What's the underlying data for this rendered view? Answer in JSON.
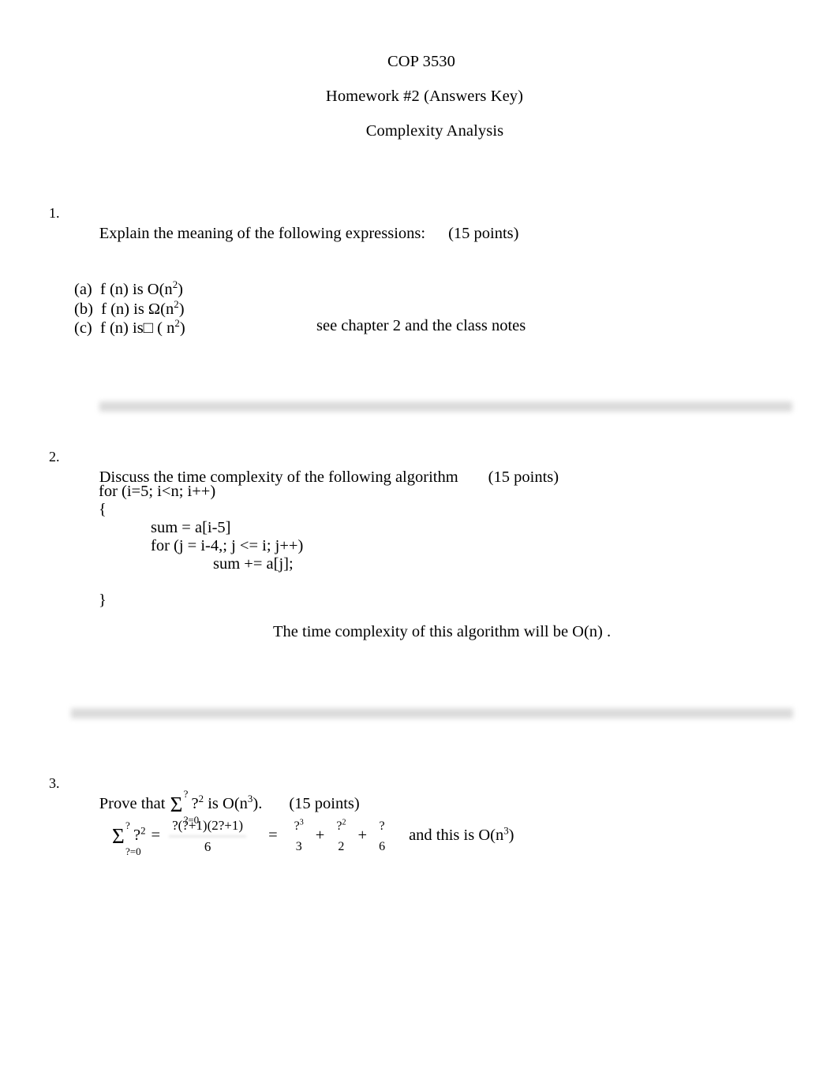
{
  "document": {
    "header": {
      "course": "COP 3530",
      "assignment": "Homework #2 (Answers Key)",
      "subject": "Complexity Analysis"
    },
    "questions": [
      {
        "number": "1.",
        "prompt": "Explain the meaning of the following expressions:",
        "points": "(15 points)",
        "subitems": [
          {
            "label": "(a)",
            "text": "f (n) is O(n",
            "exponent": "2",
            "tail": ")"
          },
          {
            "label": "(b)",
            "text": "f (n) is Ω(n",
            "exponent": "2",
            "tail": ")"
          },
          {
            "label": "(c)",
            "text": "f (n) is□ ( n",
            "exponent": "2",
            "tail": ")"
          }
        ],
        "answer": "see chapter 2 and the class notes"
      },
      {
        "number": "2.",
        "prompt": "Discuss the time complexity of the following algorithm",
        "points": "(15 points)",
        "code": [
          "for (i=5; i<n; i++)",
          "{",
          "sum = a[i-5]",
          "for (j = i-4,; j <= i; j++)",
          "sum += a[j];",
          "",
          "}"
        ],
        "answer": "The time complexity of this algorithm will be O(n) ."
      },
      {
        "number": "3.",
        "prompt_before_sum": "Prove that",
        "sum_upper": "?",
        "sum_lower": "?=0",
        "sum_term": "?",
        "sum_term_exp": "2",
        "prompt_after_sum": "is O(n",
        "prompt_exp": "3",
        "prompt_tail": ").",
        "points": "(15 points)",
        "formula": {
          "lhs_sum_upper": "?",
          "lhs_sum_lower": "?=0",
          "lhs_term": "?",
          "lhs_term_exp": "2",
          "eq1": "=",
          "frac1_num": "?(?+1)(2?+1)",
          "frac1_den": "6",
          "eq2": "=",
          "term1_num": "?",
          "term1_num_exp": "3",
          "term1_den": "3",
          "plus1": "+",
          "term2_num": "?",
          "term2_num_exp": "2",
          "term2_den": "2",
          "plus2": "+",
          "term3_num": "?",
          "term3_den": "6",
          "note": "and this is O(n",
          "note_exp": "3",
          "note_tail": ")"
        }
      }
    ]
  }
}
